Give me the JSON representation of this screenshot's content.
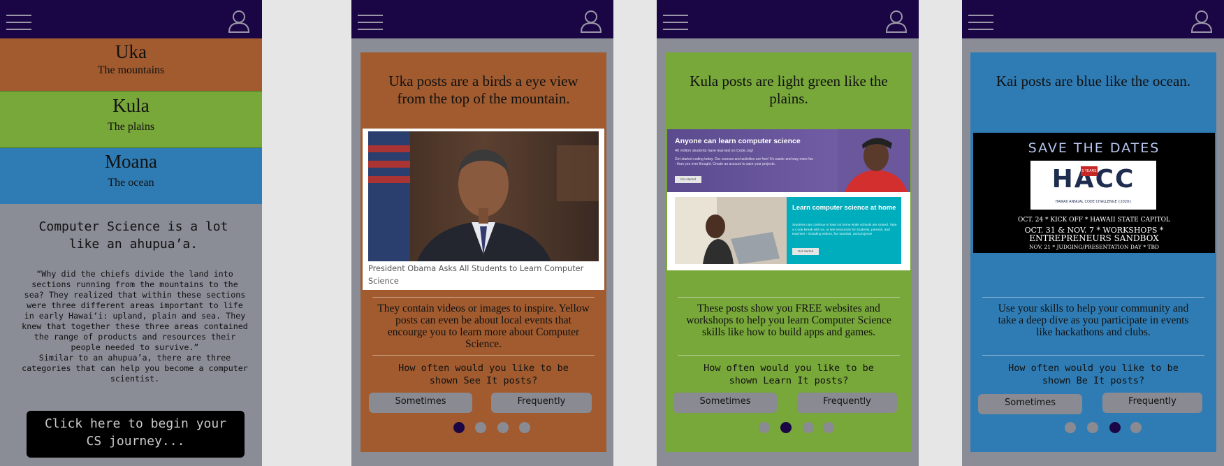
{
  "colors": {
    "topbar": "#1b0645",
    "uka": "#a15b2f",
    "kula": "#78a73a",
    "moana": "#2f7cb4",
    "gray_bg": "#8a8c96",
    "button": "#8a8a92"
  },
  "icons": {
    "menu": "hamburger-icon",
    "profile": "user-icon"
  },
  "screen1": {
    "regions": [
      {
        "title": "Uka",
        "subtitle": "The mountains"
      },
      {
        "title": "Kula",
        "subtitle": "The plains"
      },
      {
        "title": "Moana",
        "subtitle": "The ocean"
      }
    ],
    "heading": "Computer Science is a lot like an ahupua’a.",
    "quote": "“Why did the chiefs divide the land into sections running from the mountains to the sea? They realized that within these sections were three different areas important to life in early Hawai‘i: upland, plain and sea. They knew that together these three areas contained the range of products and resources their people needed to survive.”",
    "quote_end": "Similar to an ahupua’a, there are three categories that can help you become a computer scientist.",
    "cta": "Click here to begin your CS journey..."
  },
  "screen2": {
    "title": "Uka posts are a birds a eye view from the top of the mountain.",
    "caption": "President Obama Asks All Students to Learn Computer Science",
    "description": "They contain videos or images to inspire. Yellow posts can even be about local events that encourge you to learn more about Computer Science.",
    "question": "How often would you like to be shown See It posts?",
    "btn_sometimes": "Sometimes",
    "btn_frequently": "Frequently",
    "active_dot": 0
  },
  "screen3": {
    "title": "Kula posts are light green like the plains.",
    "banner1_title": "Anyone can learn computer science",
    "banner1_sub": "40 million students have learned on Code.org!",
    "banner1_body": "Get started coding today. Our courses and activities are free! It's easier and way more fun - than you ever thought. Create an account to save your projects.",
    "banner1_btn": "Get started",
    "banner2_title": "Learn computer science at home",
    "banner2_body": "Students can continue to learn at home while schools are closed. Take a Code Break with us, or see resources for students, parents, and teachers - including videos, fun tutorials, and projects!",
    "banner2_btn": "Get started",
    "description": "These posts show you FREE websites and workshops to help you learn Computer Science skills like how to build apps and games.",
    "question": "How often would you like to be shown Learn It posts?",
    "btn_sometimes": "Sometimes",
    "btn_frequently": "Frequently",
    "active_dot": 1
  },
  "screen4": {
    "title": "Kai posts are blue like the ocean.",
    "poster_header": "SAVE THE DATES",
    "poster_logo": "HACC",
    "poster_logo_badge": "5 YEARS",
    "poster_logo_sub": "HAWAII ANNUAL CODE CHALLENGE {2020}",
    "poster_line1": "OCT. 24 * KICK OFF * HAWAII STATE CAPITOL",
    "poster_line2": "OCT. 31 & NOV. 7 * WORKSHOPS *",
    "poster_line3": "ENTREPRENEURS SANDBOX",
    "poster_line4": "NOV. 21 * JUDGING/PRESENTATION DAY * TBD",
    "description": "Use your skills to help your community and take a deep dive as you participate in events like hackathons and clubs.",
    "question": "How often would you like to be shown Be It posts?",
    "btn_sometimes": "Sometimes",
    "btn_frequently": "Frequently",
    "active_dot": 2
  }
}
